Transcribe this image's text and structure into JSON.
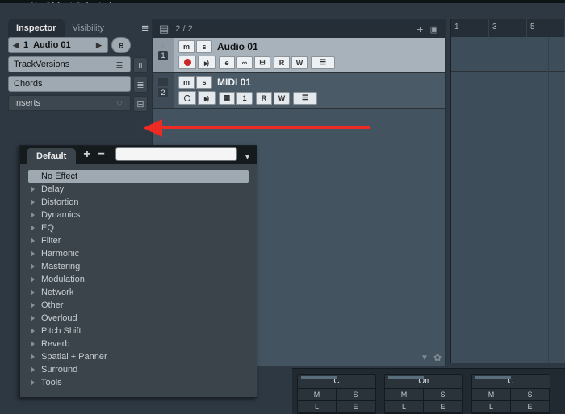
{
  "status": {
    "text": "No Object Selected"
  },
  "tabs": {
    "inspector": "Inspector",
    "visibility": "Visibility"
  },
  "inspector": {
    "track_number": "1",
    "track_name": "Audio 01",
    "e_label": "e",
    "sections": {
      "track_versions": "TrackVersions",
      "chords": "Chords",
      "inserts": "Inserts"
    }
  },
  "tracklist": {
    "counter": "2 / 2",
    "tracks": [
      {
        "num": "1",
        "name": "Audio 01",
        "mute": "m",
        "solo": "s",
        "e": "e",
        "read": "R",
        "write": "W"
      },
      {
        "num": "2",
        "name": "MIDI 01",
        "mute": "m",
        "solo": "s",
        "lane": "1",
        "read": "R",
        "write": "W"
      }
    ]
  },
  "ruler": {
    "marks": [
      "1",
      "3",
      "5"
    ]
  },
  "popup": {
    "preset_tab": "Default",
    "categories": [
      "No Effect",
      "Delay",
      "Distortion",
      "Dynamics",
      "EQ",
      "Filter",
      "Harmonic",
      "Mastering",
      "Modulation",
      "Network",
      "Other",
      "Overloud",
      "Pitch Shift",
      "Reverb",
      "Spatial + Panner",
      "Surround",
      "Tools"
    ]
  },
  "lower": {
    "strips": [
      {
        "top": "C",
        "row1": [
          "M",
          "S"
        ],
        "row2": [
          "L",
          "E"
        ]
      },
      {
        "top": "Off",
        "row1": [
          "M",
          "S"
        ],
        "row2": [
          "L",
          "E"
        ]
      },
      {
        "top": "C",
        "row1": [
          "M",
          "S"
        ],
        "row2": [
          "L",
          "E"
        ]
      }
    ]
  }
}
